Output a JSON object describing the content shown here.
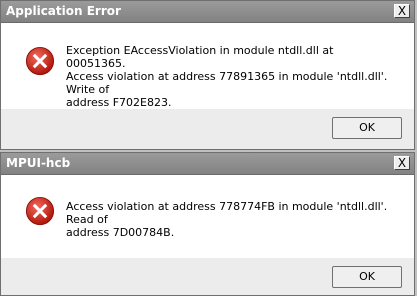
{
  "dialogs": [
    {
      "title": "Application Error",
      "close_label": "X",
      "icon": "error-icon",
      "message": "Exception EAccessViolation in module ntdll.dll at 00051365.\nAccess violation at address 77891365 in module 'ntdll.dll'. Write of\naddress F702E823.",
      "ok_label": "OK"
    },
    {
      "title": "MPUI-hcb",
      "close_label": "X",
      "icon": "error-icon",
      "message": "Access violation at address 778774FB in module 'ntdll.dll'. Read of\naddress 7D00784B.",
      "ok_label": "OK"
    }
  ],
  "colors": {
    "titlebar": "#8e8e8e",
    "dialog_body": "#ffffff",
    "dialog_footer": "#ececec",
    "error_icon_fill": "#d52b1e",
    "error_icon_glyph": "#ffffff"
  }
}
